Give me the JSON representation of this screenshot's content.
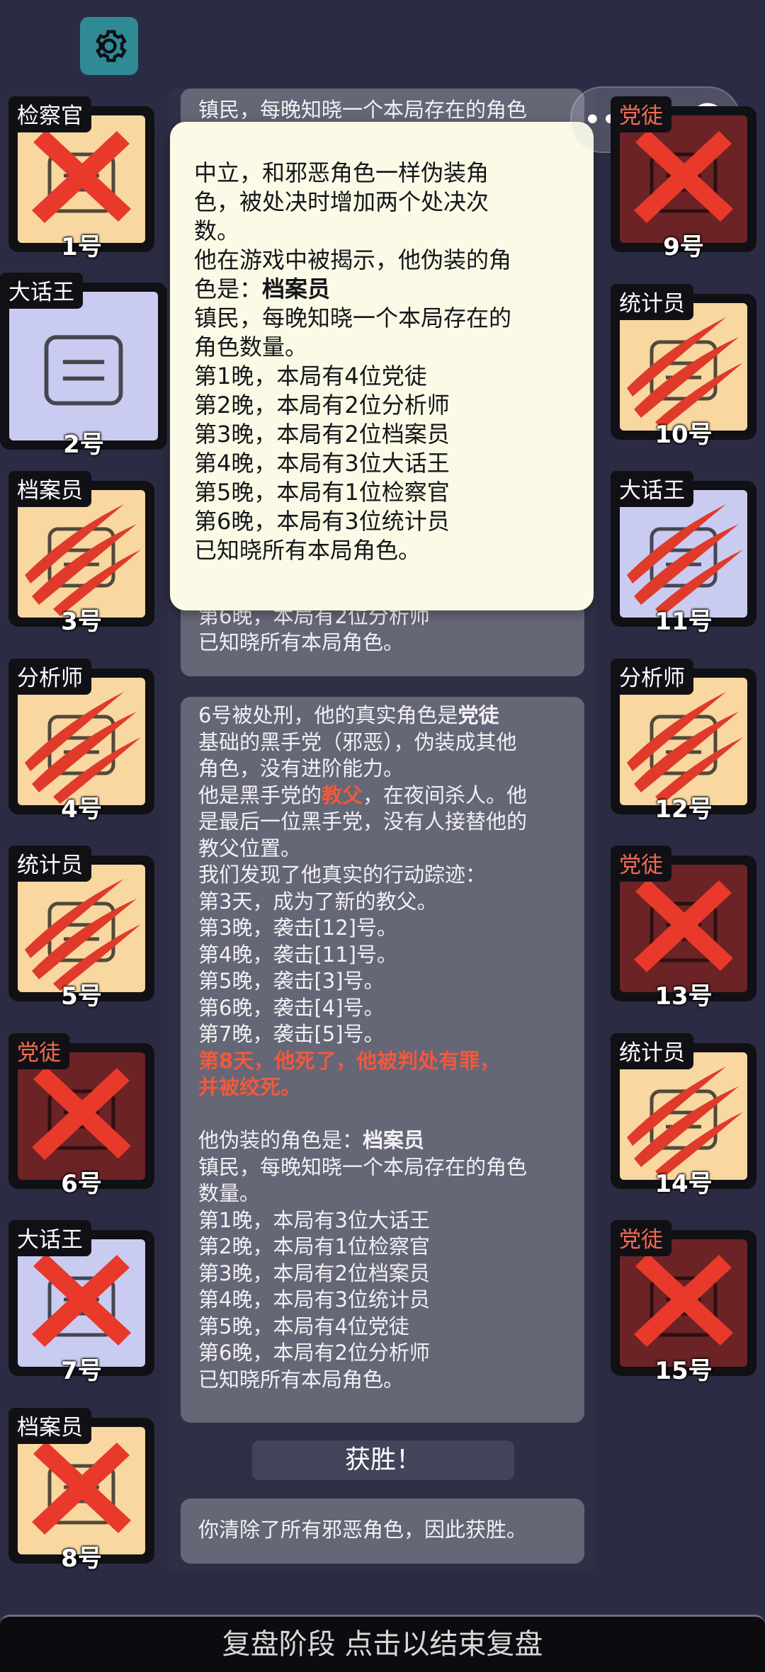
{
  "settings_icon": "gear-icon",
  "capsule": {
    "more_icon": "more-dots-icon",
    "record_icon": "record-target-icon"
  },
  "left_cards": [
    {
      "label": "检察官",
      "number": "1号",
      "face": "town",
      "mark": "cross",
      "evil_label": false
    },
    {
      "label": "大话王",
      "number": "2号",
      "face": "lilac",
      "mark": "none",
      "evil_label": false,
      "big": true
    },
    {
      "label": "档案员",
      "number": "3号",
      "face": "town",
      "mark": "claw",
      "evil_label": false
    },
    {
      "label": "分析师",
      "number": "4号",
      "face": "town",
      "mark": "claw",
      "evil_label": false
    },
    {
      "label": "统计员",
      "number": "5号",
      "face": "town",
      "mark": "claw",
      "evil_label": false
    },
    {
      "label": "党徒",
      "number": "6号",
      "face": "evil",
      "mark": "cross",
      "evil_label": true
    },
    {
      "label": "大话王",
      "number": "7号",
      "face": "lilac",
      "mark": "cross",
      "evil_label": false
    },
    {
      "label": "档案员",
      "number": "8号",
      "face": "town",
      "mark": "cross",
      "evil_label": false
    }
  ],
  "right_cards": [
    {
      "label": "党徒",
      "number": "9号",
      "face": "evil",
      "mark": "cross",
      "evil_label": true
    },
    {
      "label": "统计员",
      "number": "10号",
      "face": "town",
      "mark": "claw",
      "evil_label": false
    },
    {
      "label": "大话王",
      "number": "11号",
      "face": "lilac",
      "mark": "claw",
      "evil_label": false
    },
    {
      "label": "分析师",
      "number": "12号",
      "face": "town",
      "mark": "claw",
      "evil_label": false
    },
    {
      "label": "党徒",
      "number": "13号",
      "face": "evil",
      "mark": "cross",
      "evil_label": true
    },
    {
      "label": "统计员",
      "number": "14号",
      "face": "town",
      "mark": "claw",
      "evil_label": false
    },
    {
      "label": "党徒",
      "number": "15号",
      "face": "evil",
      "mark": "cross",
      "evil_label": true
    }
  ],
  "top_message": {
    "line1": "镇民，每晚知晓一个本局存在的角色",
    "line2": "第6晚，本局有2位分析师",
    "line3": "已知晓所有本局角色。"
  },
  "popup": {
    "l1": "中立，和邪恶角色一样伪装角",
    "l2": "色，被处决时增加两个处决次",
    "l3": "数。",
    "l4": "他在游戏中被揭示，他伪装的角",
    "l5a": "色是：",
    "l5b": "档案员",
    "l6": "镇民，每晚知晓一个本局存在的",
    "l7": "角色数量。",
    "l8": "第1晚，本局有4位党徒",
    "l9": "第2晚，本局有2位分析师",
    "l10": "第3晚，本局有2位档案员",
    "l11": "第4晚，本局有3位大话王",
    "l12": "第5晚，本局有1位检察官",
    "l13": "第6晚，本局有3位统计员",
    "l14": "已知晓所有本局角色。"
  },
  "exec_message": {
    "l1a": "6号被处刑，他的真实角色是",
    "l1b": "党徒",
    "l2": "基础的黑手党（邪恶），伪装成其他",
    "l3": "角色，没有进阶能力。",
    "l4a": "他是黑手党的",
    "l4b": "教父",
    "l4c": "，在夜间杀人。他",
    "l5": "是最后一位黑手党，没有人接替他的",
    "l6": "教父位置。",
    "l7": "我们发现了他真实的行动踪迹：",
    "l8": "第3天，成为了新的教父。",
    "l9": "第3晚，袭击[12]号。",
    "l10": "第4晚，袭击[11]号。",
    "l11": "第5晚，袭击[3]号。",
    "l12": "第6晚，袭击[4]号。",
    "l13": "第7晚，袭击[5]号。",
    "l14": "第8天，他死了，他被判处有罪，",
    "l15": "并被绞死。",
    "l16a": "他伪装的角色是：",
    "l16b": "档案员",
    "l17": "镇民，每晚知晓一个本局存在的角色",
    "l18": "数量。",
    "l19": "第1晚，本局有3位大话王",
    "l20": "第2晚，本局有1位检察官",
    "l21": "第3晚，本局有2位档案员",
    "l22": "第4晚，本局有3位统计员",
    "l23": "第5晚，本局有4位党徒",
    "l24": "第6晚，本局有2位分析师",
    "l25": "已知晓所有本局角色。"
  },
  "victory_label": "获胜！",
  "win_message": "你清除了所有邪恶角色，因此获胜。",
  "bottom_bar": "复盘阶段 点击以结束复盘",
  "colors": {
    "background": "#2b2c43",
    "town_face": "#f8d7a1",
    "evil_face": "#6b2325",
    "lilac_face": "#cacbf1",
    "accent_red": "#f0593b",
    "popup_bg": "#fafae6"
  }
}
